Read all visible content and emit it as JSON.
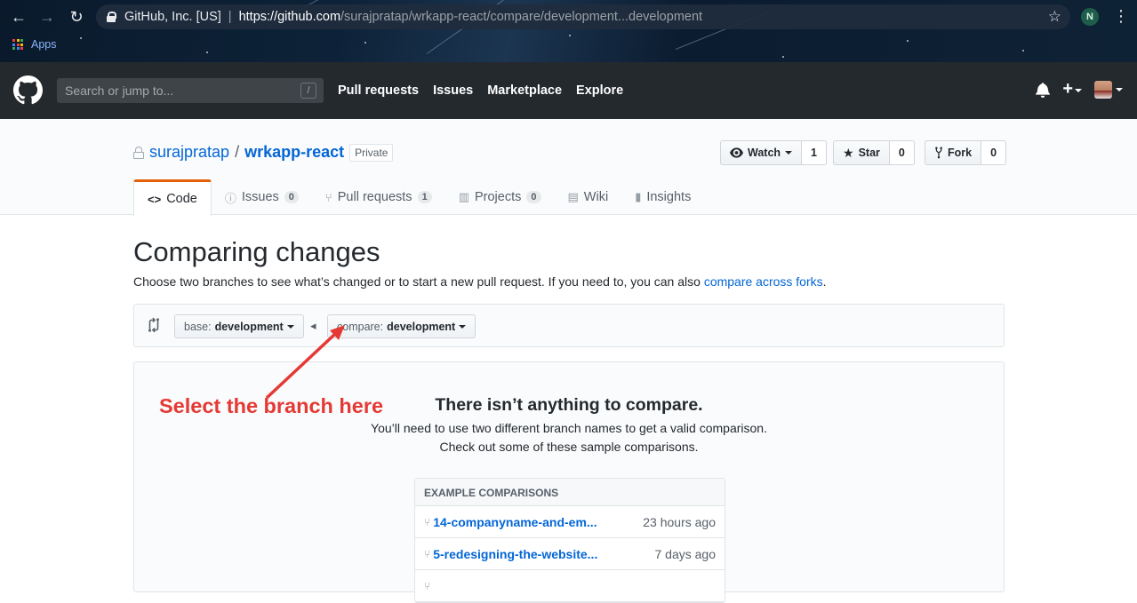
{
  "browser": {
    "omnibox_host": "GitHub, Inc. [US]",
    "url_prefix": "https://github.com",
    "url_path": "/surajpratap/wrkapp-react/compare/development...development",
    "profile_initial": "N",
    "bookmarks_apps_label": "Apps"
  },
  "header": {
    "search_placeholder": "Search or jump to...",
    "search_shortcut": "/",
    "nav": [
      "Pull requests",
      "Issues",
      "Marketplace",
      "Explore"
    ]
  },
  "repo": {
    "owner": "surajpratap",
    "separator": "/",
    "name": "wrkapp-react",
    "visibility": "Private",
    "watch_label": "Watch",
    "watch_count": "1",
    "star_label": "Star",
    "star_count": "0",
    "fork_label": "Fork",
    "fork_count": "0"
  },
  "tabs": [
    {
      "label": "Code",
      "icon": "code-icon",
      "counter": null,
      "selected": true
    },
    {
      "label": "Issues",
      "icon": "issue-icon",
      "counter": "0"
    },
    {
      "label": "Pull requests",
      "icon": "pull-request-icon",
      "counter": "1"
    },
    {
      "label": "Projects",
      "icon": "project-icon",
      "counter": "0"
    },
    {
      "label": "Wiki",
      "icon": "book-icon",
      "counter": null
    },
    {
      "label": "Insights",
      "icon": "graph-icon",
      "counter": null
    }
  ],
  "main": {
    "title": "Comparing changes",
    "description_prefix": "Choose two branches to see what’s changed or to start a new pull request. If you need to, you can also ",
    "description_link": "compare across forks",
    "description_suffix": ".",
    "base_label": "base:",
    "base_branch": "development",
    "compare_label": "compare:",
    "compare_branch": "development"
  },
  "blankslate": {
    "title": "There isn’t anything to compare.",
    "line1": "You’ll need to use two different branch names to get a valid comparison.",
    "line2": "Check out some of these sample comparisons.",
    "annotation": "Select the branch here",
    "examples_header": "EXAMPLE COMPARISONS",
    "examples": [
      {
        "branch": "14-companyname-and-em...",
        "time": "23 hours ago"
      },
      {
        "branch": "5-redesigning-the-website...",
        "time": "7 days ago"
      }
    ]
  },
  "colors": {
    "link": "#0366d6",
    "annotation": "#e53935",
    "header_bg": "#24292e",
    "tab_accent": "#e36209"
  }
}
